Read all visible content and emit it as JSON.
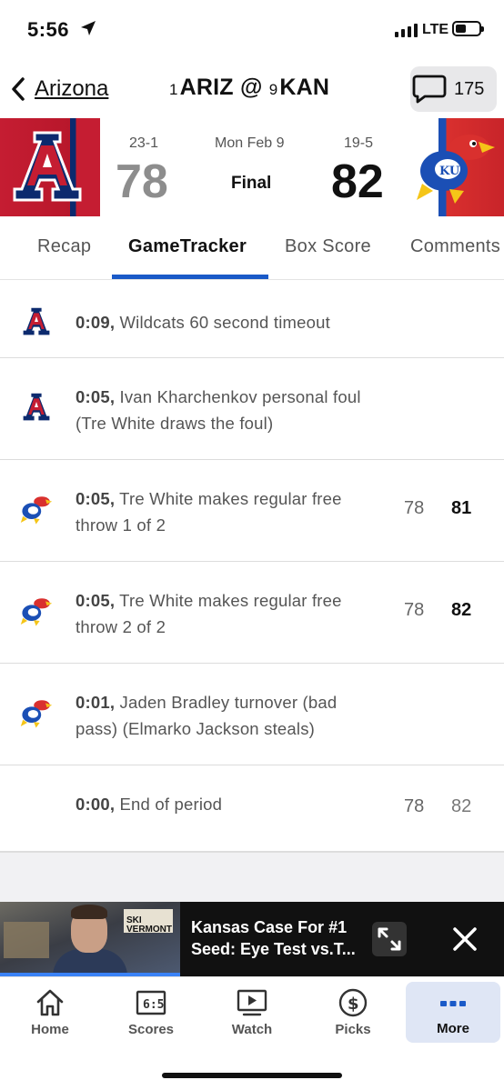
{
  "status_bar": {
    "time": "5:56",
    "network": "LTE"
  },
  "header": {
    "back_label": "Arizona",
    "away": {
      "rank": "1",
      "abbr": "ARIZ"
    },
    "at": "@",
    "home": {
      "rank": "9",
      "abbr": "KAN"
    },
    "comment_count": "175"
  },
  "scoreboard": {
    "away_record": "23-1",
    "away_score": "78",
    "date": "Mon Feb 9",
    "status": "Final",
    "home_record": "19-5",
    "home_score": "82",
    "colors": {
      "arizona_red": "#c51d32",
      "arizona_navy": "#0c2a6e",
      "kansas_blue": "#1b4fb5",
      "kansas_red": "#d9302e"
    }
  },
  "tabs": [
    "Recap",
    "GameTracker",
    "Box Score",
    "Comments"
  ],
  "active_tab": "GameTracker",
  "plays": [
    {
      "team": "arizona",
      "time": "0:09,",
      "text": " Wildcats 60 second timeout",
      "away": "",
      "home": ""
    },
    {
      "team": "arizona",
      "time": "0:05,",
      "text": " Ivan Kharchenkov personal foul (Tre White draws the foul)",
      "away": "",
      "home": ""
    },
    {
      "team": "kansas",
      "time": "0:05,",
      "text": " Tre White makes regular free throw 1 of 2",
      "away": "78",
      "home": "81"
    },
    {
      "team": "kansas",
      "time": "0:05,",
      "text": " Tre White makes regular free throw 2 of 2",
      "away": "78",
      "home": "82"
    },
    {
      "team": "kansas",
      "time": "0:01,",
      "text": " Jaden Bradley turnover (bad pass) (Elmarko Jackson steals)",
      "away": "",
      "home": ""
    },
    {
      "team": "",
      "time": "0:00,",
      "text": " End of period",
      "away": "78",
      "home": "82"
    }
  ],
  "video": {
    "title": "Kansas Case For #1 Seed: Eye Test vs.T...",
    "thumbnail_sign": "SKI VERMONT"
  },
  "bottom_nav": [
    {
      "label": "Home",
      "icon": "home-icon"
    },
    {
      "label": "Scores",
      "icon": "scores-icon",
      "icon_text": "6:5"
    },
    {
      "label": "Watch",
      "icon": "watch-icon"
    },
    {
      "label": "Picks",
      "icon": "picks-icon"
    },
    {
      "label": "More",
      "icon": "more-icon",
      "active": true
    }
  ]
}
